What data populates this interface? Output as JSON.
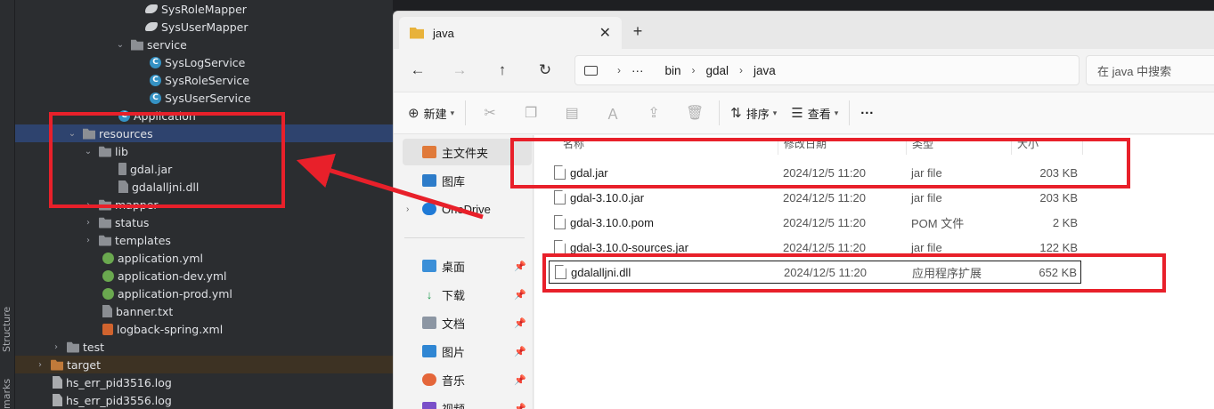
{
  "ide": {
    "strip_labels": [
      "Structure",
      "marks"
    ],
    "tree": [
      {
        "label": "SysRoleMapper",
        "icon": "mapper-icon",
        "indent": 3
      },
      {
        "label": "SysUserMapper",
        "icon": "mapper-icon",
        "indent": 3
      },
      {
        "label": "service",
        "icon": "package-icon",
        "indent": 2,
        "expanded": true
      },
      {
        "label": "SysLogService",
        "icon": "class-icon",
        "indent": 3
      },
      {
        "label": "SysRoleService",
        "icon": "class-icon",
        "indent": 3
      },
      {
        "label": "SysUserService",
        "icon": "class-icon",
        "indent": 3
      },
      {
        "label": "Application",
        "icon": "class-icon",
        "indent": 2
      },
      {
        "label": "resources",
        "icon": "resources-folder-icon",
        "indent": 1,
        "expanded": true,
        "selected": true
      },
      {
        "label": "lib",
        "icon": "folder-icon",
        "indent": 2,
        "expanded": true
      },
      {
        "label": "gdal.jar",
        "icon": "jar-icon",
        "indent": 3
      },
      {
        "label": "gdalalljni.dll",
        "icon": "file-icon",
        "indent": 3
      },
      {
        "label": "mapper",
        "icon": "folder-icon",
        "indent": 2,
        "collapsed": true
      },
      {
        "label": "status",
        "icon": "folder-icon",
        "indent": 2,
        "collapsed": true
      },
      {
        "label": "templates",
        "icon": "folder-icon",
        "indent": 2,
        "collapsed": true
      },
      {
        "label": "application.yml",
        "icon": "yaml-icon",
        "indent": 2
      },
      {
        "label": "application-dev.yml",
        "icon": "yaml-icon",
        "indent": 2
      },
      {
        "label": "application-prod.yml",
        "icon": "yaml-icon",
        "indent": 2
      },
      {
        "label": "banner.txt",
        "icon": "text-file-icon",
        "indent": 2
      },
      {
        "label": "logback-spring.xml",
        "icon": "xml-icon",
        "indent": 2
      },
      {
        "label": "test",
        "icon": "folder-icon",
        "indent": 1,
        "collapsed": true
      },
      {
        "label": "target",
        "icon": "folder-orange-icon",
        "indent": 0,
        "collapsed": true,
        "excluded": true
      },
      {
        "label": "hs_err_pid3516.log",
        "icon": "log-icon",
        "indent": 0
      },
      {
        "label": "hs_err_pid3556.log",
        "icon": "log-icon",
        "indent": 0
      }
    ]
  },
  "explorer": {
    "tab_title": "java",
    "tab_close": "✕",
    "new_tab": "+",
    "nav": {
      "back": "←",
      "forward": "→",
      "up": "↑",
      "refresh": "↻"
    },
    "breadcrumb": [
      "bin",
      "gdal",
      "java"
    ],
    "breadcrumb_more": "···",
    "search_placeholder": "在 java 中搜索",
    "toolbar": {
      "new_label": "新建",
      "sort_label": "排序",
      "view_label": "查看",
      "more": "···"
    },
    "sidebar": {
      "home": "主文件夹",
      "gallery": "图库",
      "onedrive": "OneDrive",
      "pinned": [
        "桌面",
        "下载",
        "文档",
        "图片",
        "音乐",
        "视频"
      ]
    },
    "columns": {
      "name": "名称",
      "date": "修改日期",
      "type": "类型",
      "size": "大小"
    },
    "files": [
      {
        "name": "gdal.jar",
        "date": "2024/12/5 11:20",
        "type": "jar file",
        "size": "203 KB"
      },
      {
        "name": "gdal-3.10.0.jar",
        "date": "2024/12/5 11:20",
        "type": "jar file",
        "size": "203 KB"
      },
      {
        "name": "gdal-3.10.0.pom",
        "date": "2024/12/5 11:20",
        "type": "POM 文件",
        "size": "2 KB"
      },
      {
        "name": "gdal-3.10.0-sources.jar",
        "date": "2024/12/5 11:20",
        "type": "jar file",
        "size": "122 KB"
      },
      {
        "name": "gdalalljni.dll",
        "date": "2024/12/5 11:20",
        "type": "应用程序扩展",
        "size": "652 KB",
        "selected": true
      }
    ]
  },
  "annotation": {
    "color": "#e8202a"
  }
}
